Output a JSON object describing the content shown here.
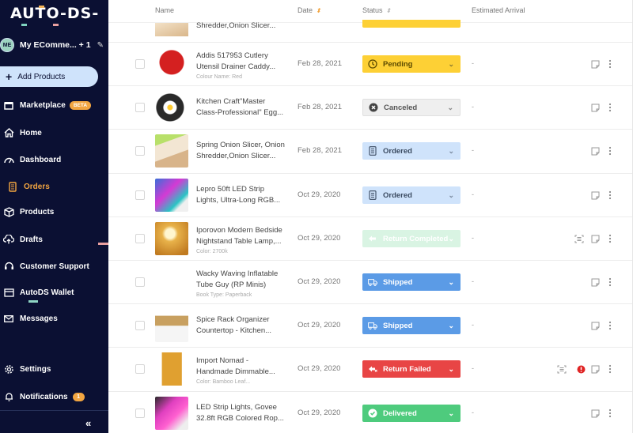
{
  "sidebar": {
    "logo": "AUTO-DS-",
    "store": {
      "initials": "ME",
      "name": "My ECommе... + 1"
    },
    "add_products": "Add Products",
    "items": [
      {
        "label": "Marketplace",
        "badge": "BETA",
        "icon": "store-icon"
      },
      {
        "label": "Home",
        "icon": "home-icon"
      },
      {
        "label": "Dashboard",
        "icon": "gauge-icon"
      },
      {
        "label": "Orders",
        "icon": "clipboard-icon",
        "active": true
      },
      {
        "label": "Products",
        "icon": "box-icon"
      },
      {
        "label": "Drafts",
        "icon": "cloud-upload-icon"
      },
      {
        "label": "Customer Support",
        "icon": "headset-icon"
      },
      {
        "label": "AutoDS Wallet",
        "icon": "wallet-icon"
      },
      {
        "label": "Messages",
        "icon": "mail-icon"
      },
      {
        "label": "Settings",
        "icon": "gear-icon"
      },
      {
        "label": "Notifications",
        "badge": "1",
        "icon": "bell-icon"
      }
    ],
    "collapse": "«"
  },
  "table": {
    "headers": {
      "name": "Name",
      "date": "Date",
      "status": "Status",
      "arrival": "Estimated Arrival"
    },
    "partial_row": {
      "name": "Shredder,Onion Slicer..."
    },
    "rows": [
      {
        "name1": "Addis 517953 Cutlery",
        "name2": "Utensil Drainer Caddy...",
        "variant": "Colour Name: Red",
        "date": "Feb 28, 2021",
        "status": "Pending",
        "arrival": "-"
      },
      {
        "name1": "Kitchen Craft\"Master",
        "name2": "Class-Professional\" Egg...",
        "variant": "",
        "date": "Feb 28, 2021",
        "status": "Canceled",
        "arrival": "-"
      },
      {
        "name1": "Spring Onion Slicer, Onion",
        "name2": "Shredder,Onion Slicer...",
        "variant": "",
        "date": "Feb 28, 2021",
        "status": "Ordered",
        "arrival": "-"
      },
      {
        "name1": "Lepro 50ft LED Strip",
        "name2": "Lights, Ultra-Long RGB...",
        "variant": "",
        "date": "Oct 29, 2020",
        "status": "Ordered",
        "arrival": "-"
      },
      {
        "name1": "Iporovon Modern Bedside",
        "name2": "Nightstand Table Lamp,...",
        "variant": "Color: 2700k",
        "date": "Oct 29, 2020",
        "status": "Return Completed",
        "arrival": "-"
      },
      {
        "name1": "Wacky Waving Inflatable",
        "name2": "Tube Guy (RP Minis)",
        "variant": "Book Type: Paperback",
        "date": "Oct 29, 2020",
        "status": "Shipped",
        "arrival": "-"
      },
      {
        "name1": "Spice Rack Organizer",
        "name2": "Countertop - Kitchen...",
        "variant": "",
        "date": "Oct 29, 2020",
        "status": "Shipped",
        "arrival": "-"
      },
      {
        "name1": "Import Nomad -",
        "name2": "Handmade Dimmable...",
        "variant": "Color: Bamboo Leaf...",
        "date": "Oct 29, 2020",
        "status": "Return Failed",
        "arrival": "-"
      },
      {
        "name1": "LED Strip Lights, Govee",
        "name2": "32.8ft RGB Colored Rop...",
        "variant": "",
        "date": "Oct 29, 2020",
        "status": "Delivered",
        "arrival": "-"
      }
    ]
  },
  "colors": {
    "sidebar_bg": "#0b1033",
    "accent": "#f2a541",
    "pending": "#fdd035",
    "canceled": "#efefef",
    "ordered": "#cfe3fb",
    "return_completed": "#d9f4e3",
    "shipped": "#5b9be6",
    "return_failed": "#e84545",
    "delivered": "#4ecb7d"
  }
}
